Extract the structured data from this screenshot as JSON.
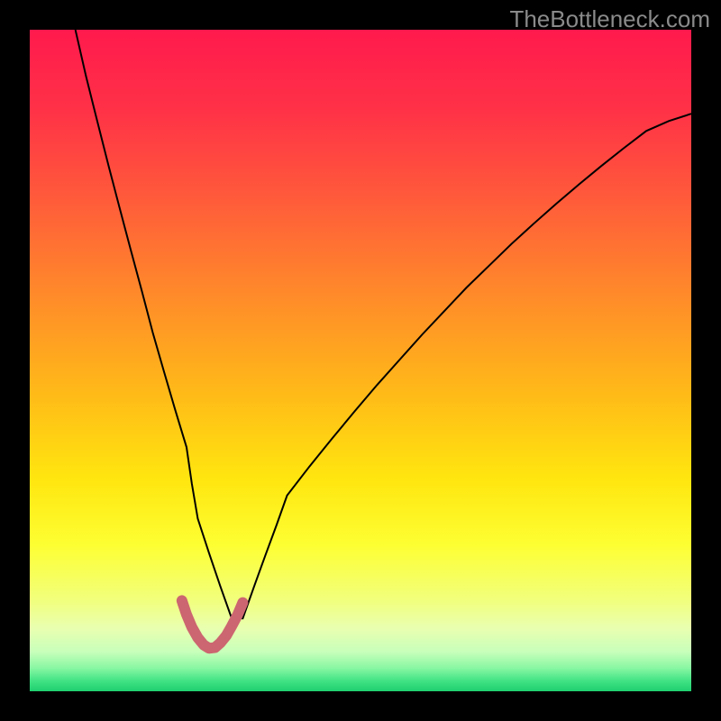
{
  "watermark": "TheBottleneck.com",
  "chart_data": {
    "type": "line",
    "title": "",
    "xlabel": "",
    "ylabel": "",
    "xlim": [
      0,
      100
    ],
    "ylim": [
      0,
      100
    ],
    "gradient_stops": [
      {
        "offset": 0.0,
        "color": "#ff1a4d"
      },
      {
        "offset": 0.12,
        "color": "#ff3147"
      },
      {
        "offset": 0.25,
        "color": "#ff593b"
      },
      {
        "offset": 0.4,
        "color": "#ff8a2a"
      },
      {
        "offset": 0.55,
        "color": "#ffba18"
      },
      {
        "offset": 0.68,
        "color": "#ffe60f"
      },
      {
        "offset": 0.78,
        "color": "#fdff33"
      },
      {
        "offset": 0.86,
        "color": "#f2ff7a"
      },
      {
        "offset": 0.905,
        "color": "#e9ffb0"
      },
      {
        "offset": 0.94,
        "color": "#c8ffbb"
      },
      {
        "offset": 0.965,
        "color": "#88f7a3"
      },
      {
        "offset": 0.985,
        "color": "#3fe283"
      },
      {
        "offset": 1.0,
        "color": "#1fcf6f"
      }
    ],
    "series": [
      {
        "name": "bottleneck-curve",
        "color": "#000000",
        "width": 2,
        "x": [
          6.9,
          8.5,
          10.2,
          11.9,
          13.6,
          15.3,
          17.0,
          18.6,
          20.3,
          22.0,
          23.7,
          24.5,
          25.4,
          27.1,
          28.8,
          30.5,
          32.2,
          33.9,
          35.6,
          37.3,
          38.9,
          42.3,
          45.7,
          49.1,
          52.5,
          55.9,
          59.3,
          62.7,
          66.0,
          69.4,
          72.8,
          76.2,
          79.6,
          83.0,
          86.4,
          89.8,
          93.2,
          96.6,
          100.0
        ],
        "y": [
          100.0,
          93.0,
          86.2,
          79.5,
          73.0,
          66.6,
          60.3,
          54.2,
          48.3,
          42.5,
          36.9,
          31.4,
          26.1,
          20.9,
          15.9,
          11.1,
          11.0,
          15.8,
          20.5,
          25.1,
          29.6,
          34.0,
          38.2,
          42.3,
          46.3,
          50.1,
          53.9,
          57.5,
          61.0,
          64.3,
          67.6,
          70.7,
          73.7,
          76.6,
          79.4,
          82.1,
          84.7,
          86.2,
          87.3
        ]
      },
      {
        "name": "optimum-marker",
        "color": "#cc6670",
        "width": 12,
        "linecap": "round",
        "x": [
          23.0,
          23.7,
          24.5,
          25.4,
          26.3,
          27.1,
          28.0,
          28.8,
          29.7,
          30.5,
          31.4,
          32.2
        ],
        "y": [
          13.7,
          11.6,
          9.7,
          8.1,
          7.0,
          6.5,
          6.6,
          7.3,
          8.4,
          9.8,
          11.5,
          13.4
        ]
      }
    ]
  }
}
